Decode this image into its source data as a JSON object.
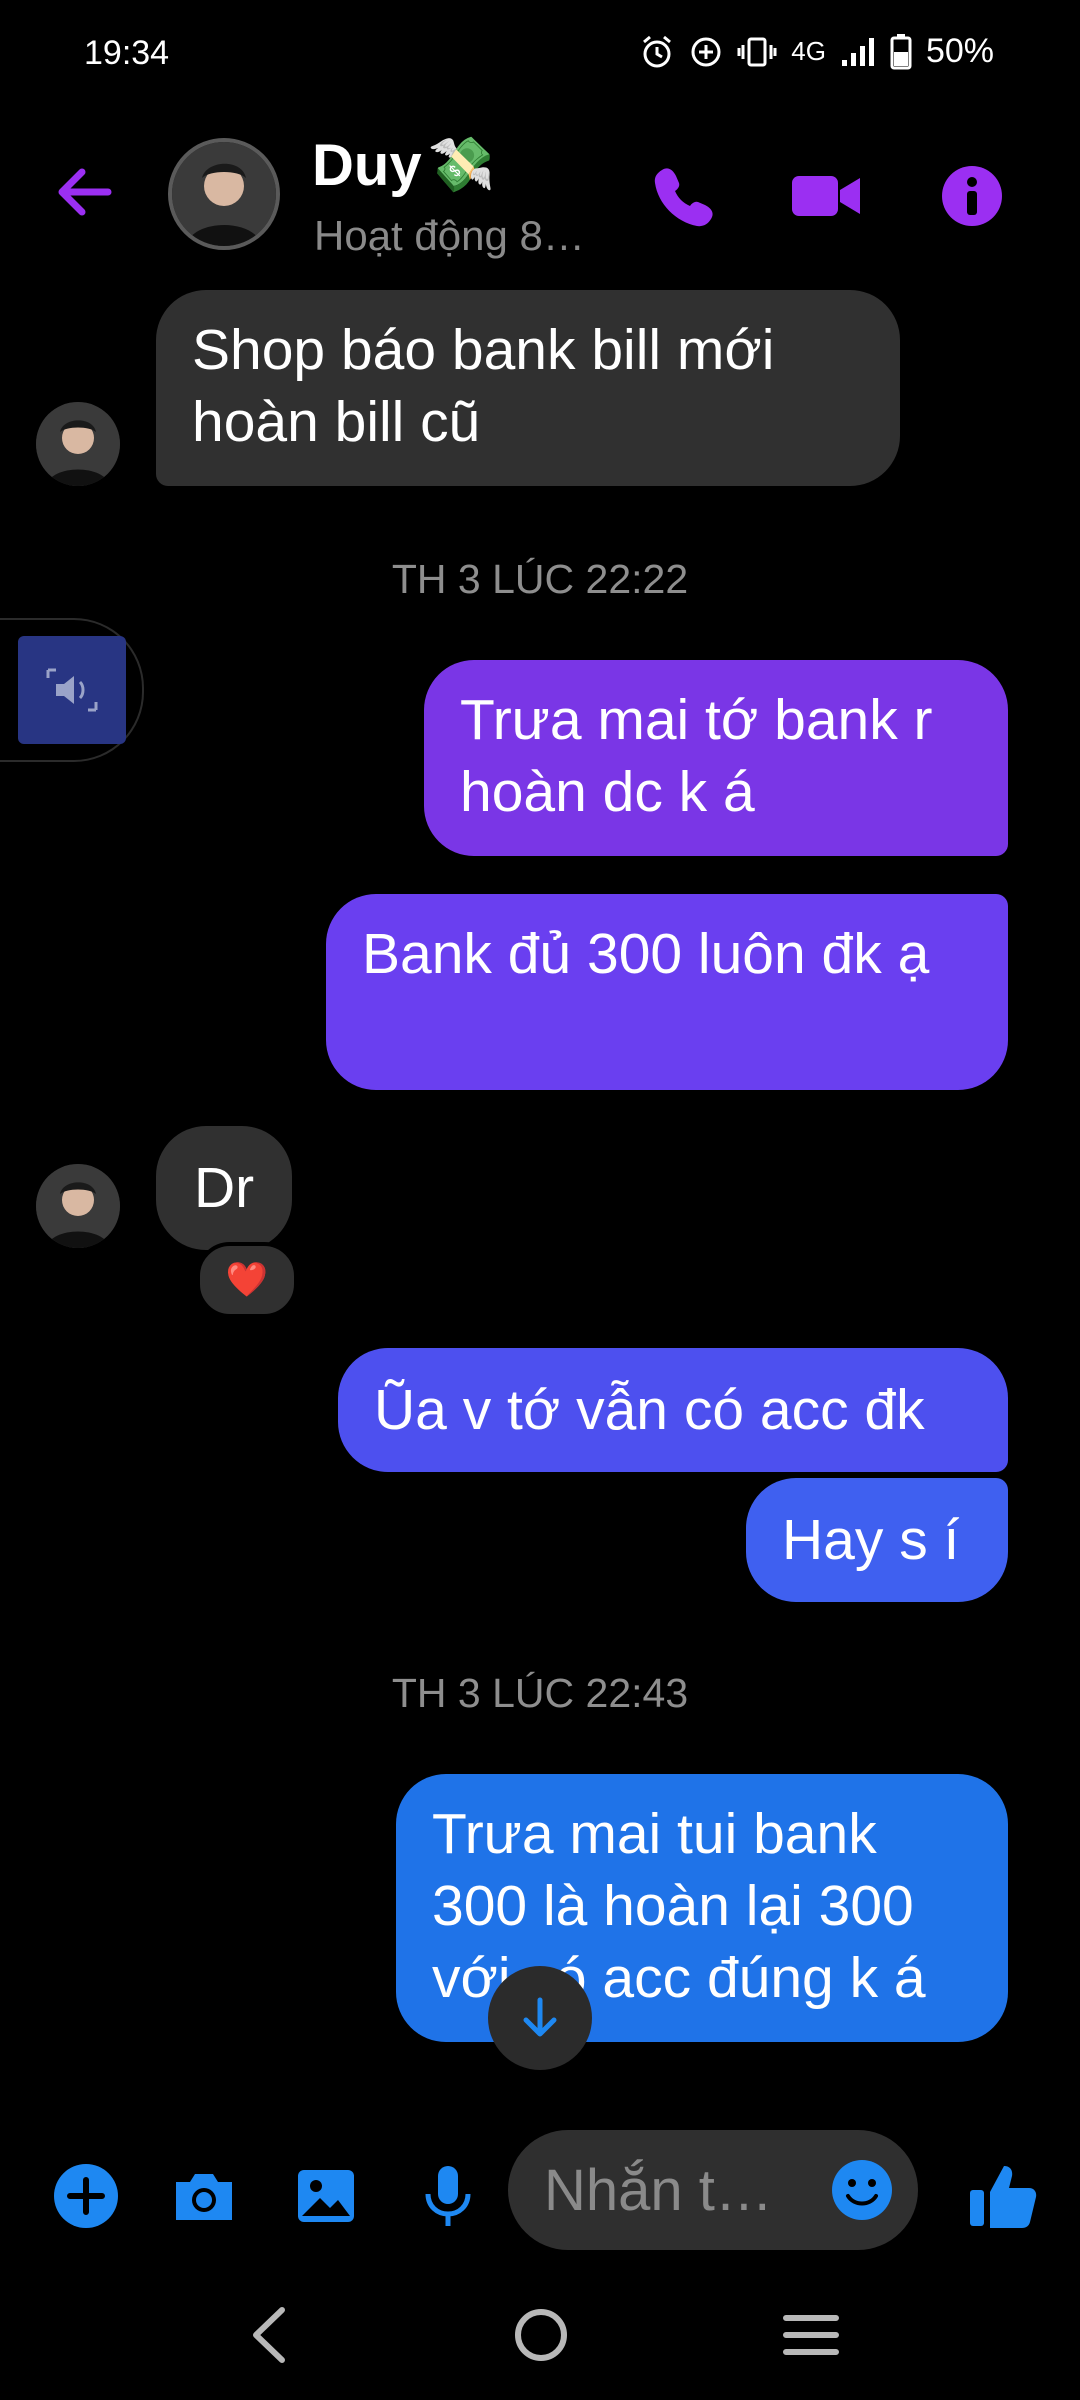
{
  "status_bar": {
    "time": "19:34",
    "network": "4G",
    "battery": "50%"
  },
  "header": {
    "contact_name": "Duy",
    "contact_emoji": "💸",
    "active_status": "Hoạt động 8…"
  },
  "messages": [
    {
      "direction": "in",
      "text": "Shop báo bank bill mới hoàn bill cũ"
    },
    {
      "direction": "out",
      "text": "Trưa mai tớ bank r hoàn dc k á"
    },
    {
      "direction": "out",
      "text": "Bank đủ 300 luôn đk ạ"
    },
    {
      "direction": "in",
      "text": "Dr",
      "reaction": "❤️"
    },
    {
      "direction": "out",
      "text": "Ũa v tớ vẫn có acc đk"
    },
    {
      "direction": "out",
      "text": "Hay s í"
    },
    {
      "direction": "out",
      "text": "Trưa mai tui bank 300 là hoàn lại 300 với có acc đúng k á"
    }
  ],
  "timestamps": [
    "TH 3 LÚC 22:22",
    "TH 3 LÚC 22:43"
  ],
  "composer": {
    "placeholder": "Nhắn t…"
  },
  "colors": {
    "accent": "#9b2ff2",
    "bubble_purple": "#7a36e6",
    "bubble_violet": "#6a3ff0",
    "bubble_indigo": "#4d50ef",
    "bubble_blue": "#1f73e8",
    "incoming": "#303030",
    "toolbar_blue": "#1e88f2"
  }
}
